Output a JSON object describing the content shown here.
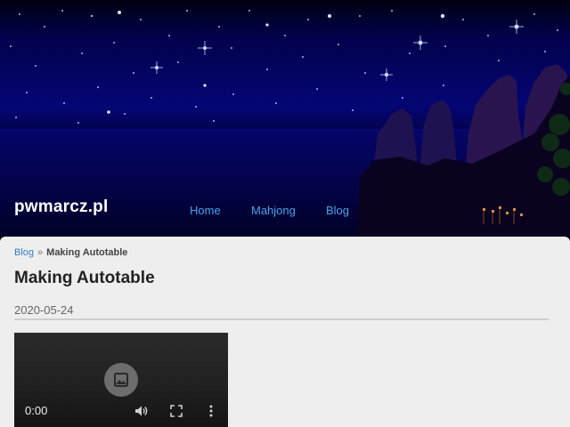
{
  "site": {
    "title": "pwmarcz.pl"
  },
  "nav": {
    "items": [
      {
        "label": "Home"
      },
      {
        "label": "Mahjong"
      },
      {
        "label": "Blog"
      }
    ]
  },
  "breadcrumb": {
    "parent": "Blog",
    "separator": "»",
    "current": "Making Autotable"
  },
  "post": {
    "title": "Making Autotable",
    "date": "2020-05-24"
  },
  "video": {
    "time": "0:00",
    "icons": [
      "image-placeholder-icon",
      "volume-icon",
      "fullscreen-icon",
      "more-vert-icon"
    ]
  },
  "colors": {
    "link": "#4aa3e8",
    "breadcrumb_link": "#2f7fc8",
    "content_bg": "#eeeeee",
    "sky": "#050575"
  }
}
